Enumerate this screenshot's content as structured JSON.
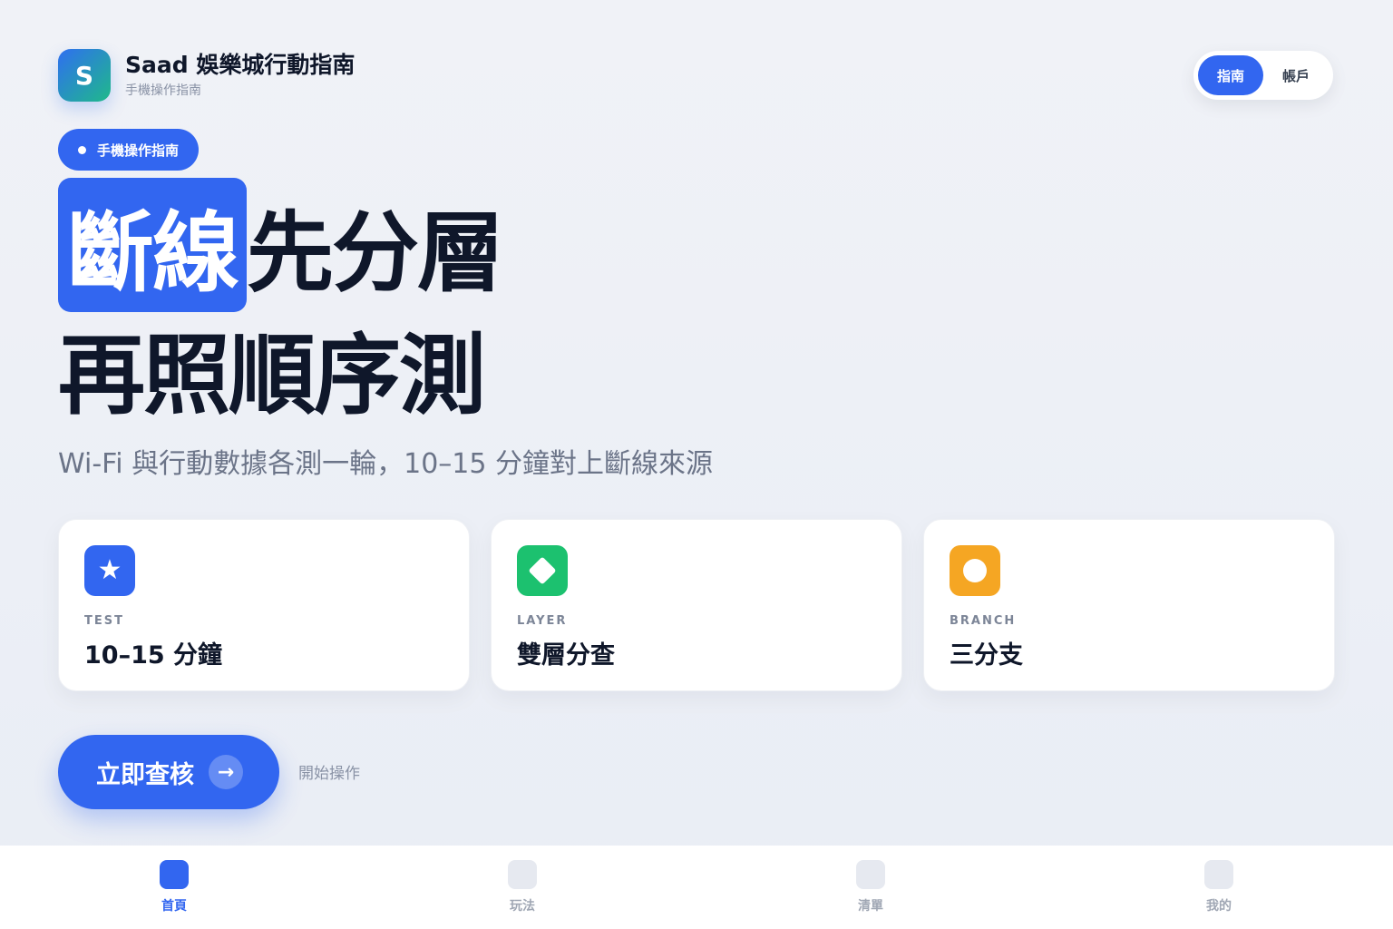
{
  "header": {
    "logo_letter": "S",
    "title": "Saad 娛樂城行動指南",
    "subtitle": "手機操作指南"
  },
  "segmented": {
    "items": [
      "指南",
      "帳戶"
    ],
    "active_index": 0
  },
  "pill": {
    "label": "手機操作指南"
  },
  "hero": {
    "highlight": "斷線",
    "line1_rest": "先分層",
    "line2": "再照順序測"
  },
  "subtitle": "Wi-Fi 與行動數據各測一輪，10–15 分鐘對上斷線來源",
  "cards": [
    {
      "kicker": "TEST",
      "value": "10–15 分鐘",
      "icon": "star-icon",
      "color": "#3266f0"
    },
    {
      "kicker": "LAYER",
      "value": "雙層分查",
      "icon": "diamond-icon",
      "color": "#1cc16f"
    },
    {
      "kicker": "BRANCH",
      "value": "三分支",
      "icon": "circle-icon",
      "color": "#f5a623"
    }
  ],
  "cta": {
    "label": "立即查核",
    "arrow": "→",
    "side_text": "開始操作"
  },
  "tabbar": {
    "items": [
      {
        "label": "首頁",
        "active": true
      },
      {
        "label": "玩法",
        "active": false
      },
      {
        "label": "清單",
        "active": false
      },
      {
        "label": "我的",
        "active": false
      }
    ]
  },
  "colors": {
    "accent": "#3266f0",
    "green": "#1cc16f",
    "orange": "#f5a623"
  }
}
